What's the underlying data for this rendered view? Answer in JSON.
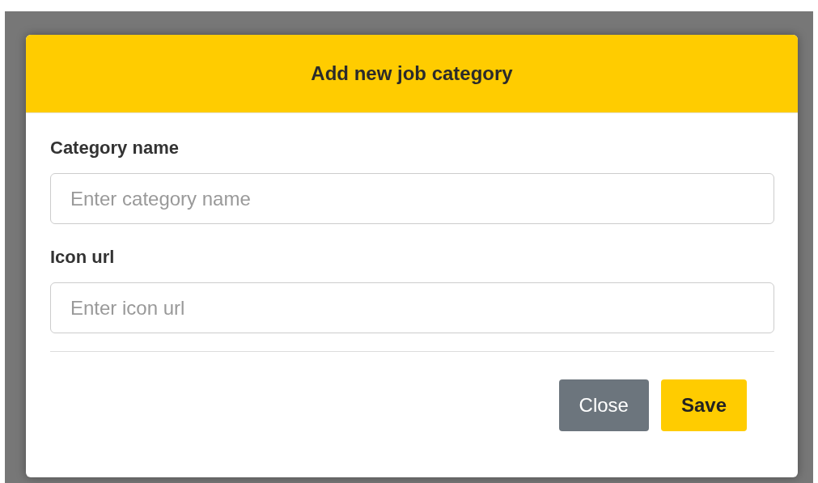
{
  "modal": {
    "title": "Add new job category",
    "fields": [
      {
        "label": "Category name",
        "placeholder": "Enter category name"
      },
      {
        "label": "Icon url",
        "placeholder": "Enter icon url"
      }
    ],
    "buttons": [
      {
        "label": "Close",
        "kind": "secondary"
      },
      {
        "label": "Save",
        "kind": "primary"
      }
    ]
  }
}
